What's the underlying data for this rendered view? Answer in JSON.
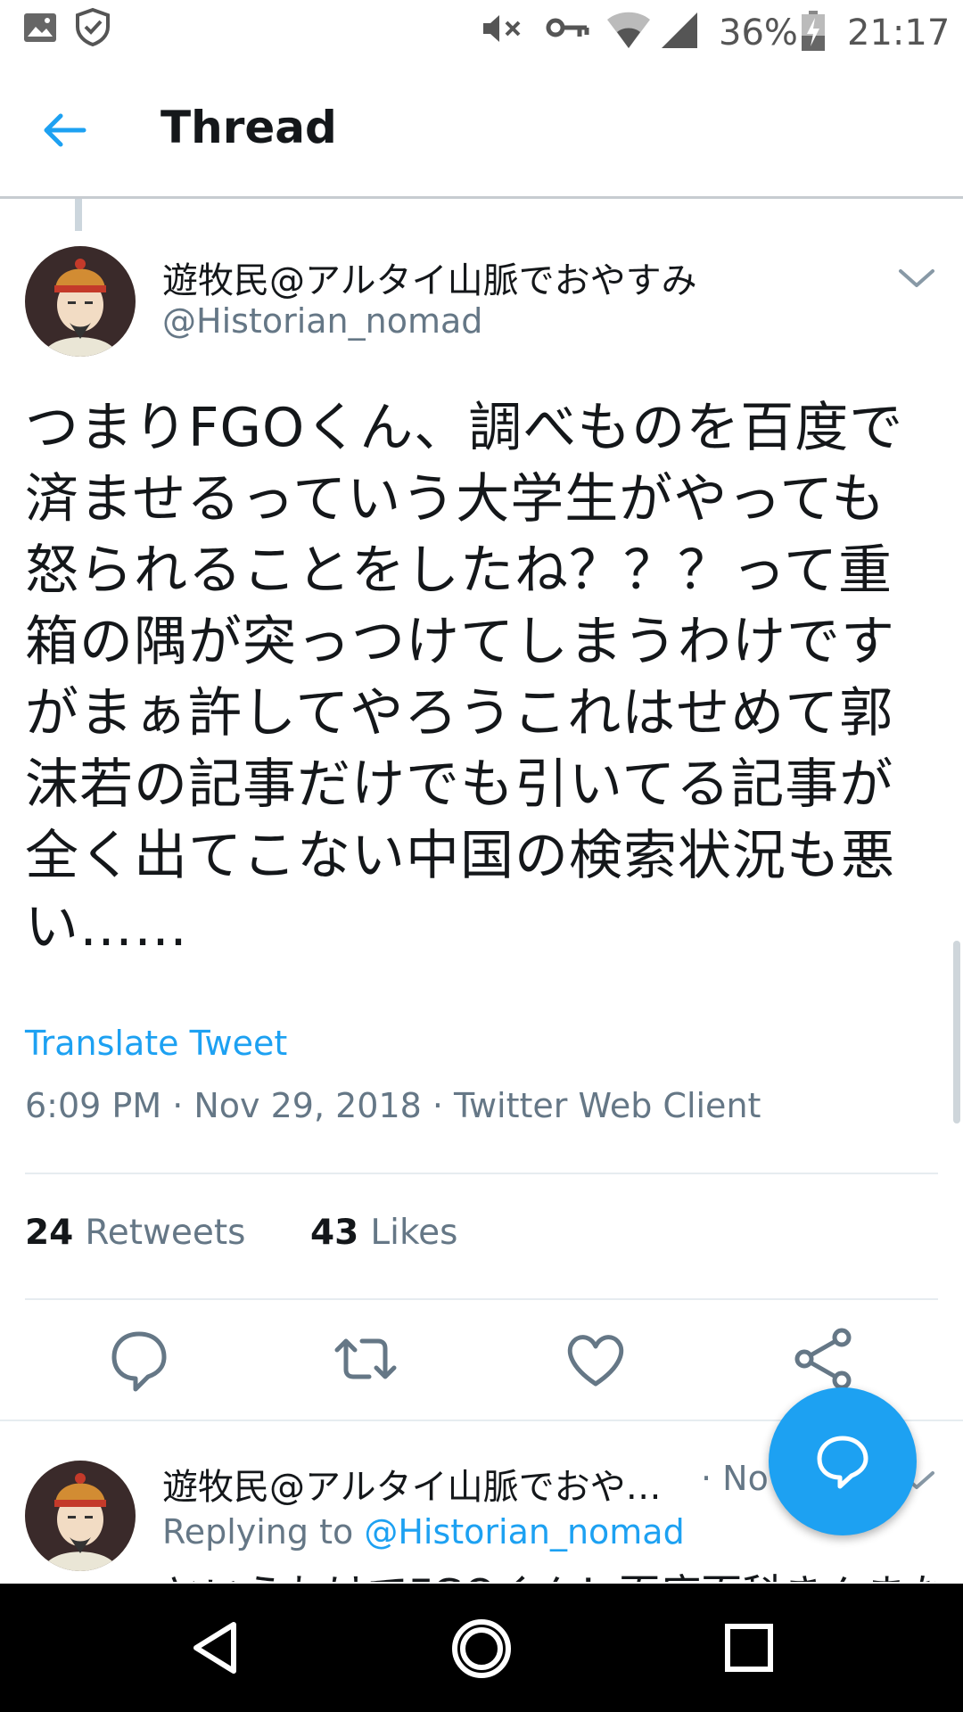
{
  "status_bar": {
    "battery": "36%",
    "time": "21:17"
  },
  "header": {
    "title": "Thread"
  },
  "tweet": {
    "author_name": "遊牧民@アルタイ山脈でおやすみ",
    "author_handle": "@Historian_nomad",
    "body_lines": [
      "つまりFGOくん、調べものを百度で",
      "済ませるっていう大学生がやっても",
      "怒られることをしたね？？？って重",
      "箱の隅が突っつけてしまうわけです",
      "がまぁ許してやろうこれはせめて郭",
      "沫若の記事だけでも引いてる記事が",
      "全く出てこない中国の検索状況も悪",
      "い……"
    ],
    "translate_label": "Translate Tweet",
    "meta": "6:09 PM · Nov 29, 2018 · Twitter Web Client",
    "retweets_count": "24",
    "retweets_label": "Retweets",
    "likes_count": "43",
    "likes_label": "Likes"
  },
  "reply": {
    "author_name": "遊牧民@アルタイ山脈でおや…",
    "time": "· No",
    "replying_prefix": "Replying to",
    "replying_handle": "@Historian_nomad",
    "body_preview": "というわけでFGOくん！百度百科きんまない"
  },
  "colors": {
    "accent": "#1da1f2",
    "text_primary": "#14171a",
    "text_secondary": "#657786"
  },
  "icons": {
    "back": "arrow-left-icon",
    "caret": "chevron-down-icon",
    "reply": "comment-icon",
    "retweet": "retweet-icon",
    "like": "heart-icon",
    "share": "share-icon",
    "fab": "compose-reply-icon"
  }
}
